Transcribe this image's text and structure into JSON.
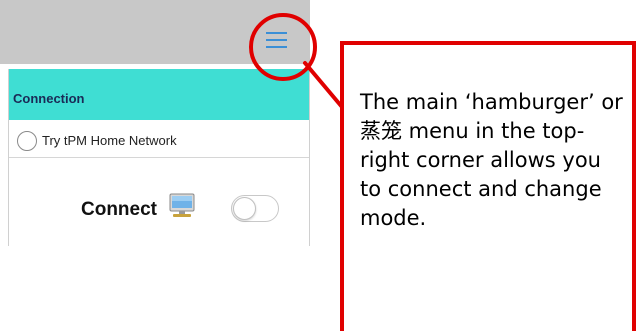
{
  "app": {
    "section_title": "Connection",
    "network_option_label": "Try tPM Home Network",
    "connect_label": "Connect",
    "menu_icon": "hamburger-menu-icon",
    "device_icon": "computer-icon",
    "toggle_state": "off"
  },
  "callout": {
    "text": "The main ‘hamburger’ or 蒸笼 menu in the top-right corner allows you to connect and change mode."
  },
  "colors": {
    "top_bar": "#c8c8c8",
    "section_header": "#3fded3",
    "menu_icon": "#3b8fd6",
    "highlight": "#e00000"
  }
}
